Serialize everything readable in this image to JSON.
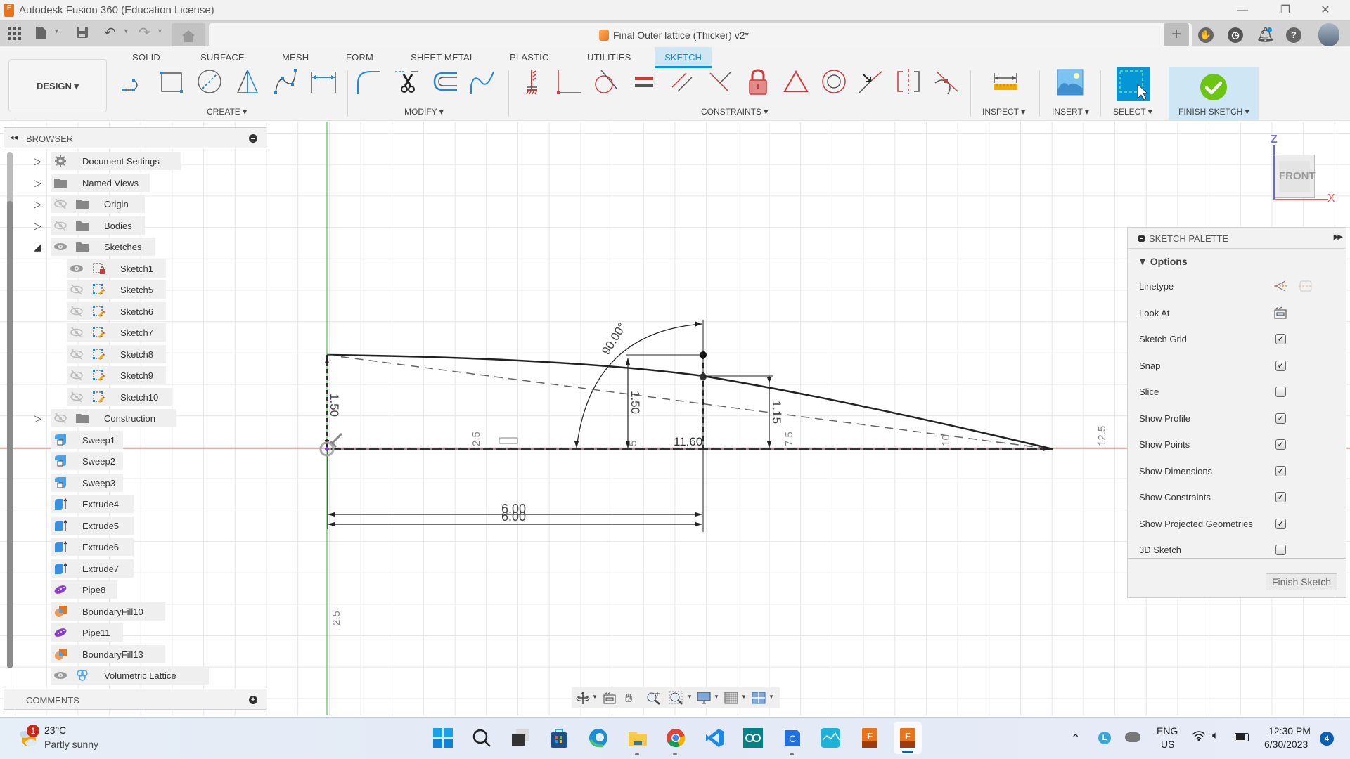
{
  "window": {
    "app_title": "Autodesk Fusion 360 (Education License)",
    "app_icon_letter": "F",
    "controls": {
      "minimize": "—",
      "restore": "❐",
      "close": "✕"
    }
  },
  "app_toolbar": {
    "document_tab": "Final Outer lattice (Thicker) v2*",
    "close_tab": "×",
    "new_tab": "+"
  },
  "ribbon": {
    "workspace": "DESIGN ▾",
    "tabs": [
      "SOLID",
      "SURFACE",
      "MESH",
      "FORM",
      "SHEET METAL",
      "PLASTIC",
      "UTILITIES",
      "SKETCH"
    ],
    "active_tab": "SKETCH",
    "groups": {
      "create": "CREATE ▾",
      "modify": "MODIFY ▾",
      "constraints": "CONSTRAINTS ▾",
      "inspect": "INSPECT ▾",
      "insert": "INSERT ▾",
      "select": "SELECT ▾",
      "finish": "FINISH SKETCH ▾"
    },
    "create_tools": [
      "line-icon",
      "rectangle-icon",
      "circle-icon",
      "polygon-icon",
      "spline-icon",
      "dimension-icon"
    ],
    "modify_tools": [
      "fillet-icon",
      "trim-icon",
      "offset-icon",
      "curve-icon"
    ],
    "constraint_tools": [
      "fix-icon",
      "perpendicular-icon",
      "tangent-icon",
      "equal-icon",
      "parallel-icon",
      "perpendicular-alt-icon",
      "lock-icon",
      "triangle-icon",
      "concentric-icon",
      "midpoint-icon",
      "symmetry-icon",
      "coincident-icon"
    ]
  },
  "browser": {
    "title": "BROWSER",
    "items": [
      {
        "label": "Document Settings",
        "icon": "gear-icon",
        "expander": "▷",
        "eye": null
      },
      {
        "label": "Named Views",
        "icon": "folder-icon",
        "expander": "▷",
        "eye": null
      },
      {
        "label": "Origin",
        "icon": "folder-icon",
        "expander": "▷",
        "eye": "hidden"
      },
      {
        "label": "Bodies",
        "icon": "folder-icon",
        "expander": "▷",
        "eye": "hidden"
      },
      {
        "label": "Sketches",
        "icon": "folder-icon",
        "expander": "◢",
        "eye": "visible"
      },
      {
        "label": "Sketch1",
        "icon": "sketch-locked-icon",
        "eye": "visible",
        "child": true
      },
      {
        "label": "Sketch5",
        "icon": "sketch-icon",
        "eye": "hidden",
        "child": true
      },
      {
        "label": "Sketch6",
        "icon": "sketch-icon",
        "eye": "hidden",
        "child": true
      },
      {
        "label": "Sketch7",
        "icon": "sketch-icon",
        "eye": "hidden",
        "child": true
      },
      {
        "label": "Sketch8",
        "icon": "sketch-icon",
        "eye": "hidden",
        "child": true
      },
      {
        "label": "Sketch9",
        "icon": "sketch-icon",
        "eye": "hidden",
        "child": true
      },
      {
        "label": "Sketch10",
        "icon": "sketch-icon",
        "eye": "hidden",
        "child": true
      },
      {
        "label": "Construction",
        "icon": "folder-icon",
        "expander": "▷",
        "eye": "hidden"
      },
      {
        "label": "Sweep1",
        "icon": "sweep-icon"
      },
      {
        "label": "Sweep2",
        "icon": "sweep-icon"
      },
      {
        "label": "Sweep3",
        "icon": "sweep-icon"
      },
      {
        "label": "Extrude4",
        "icon": "extrude-icon"
      },
      {
        "label": "Extrude5",
        "icon": "extrude-icon"
      },
      {
        "label": "Extrude6",
        "icon": "extrude-icon"
      },
      {
        "label": "Extrude7",
        "icon": "extrude-icon"
      },
      {
        "label": "Pipe8",
        "icon": "pipe-icon"
      },
      {
        "label": "BoundaryFill10",
        "icon": "boundary-fill-icon"
      },
      {
        "label": "Pipe11",
        "icon": "pipe-icon"
      },
      {
        "label": "BoundaryFill13",
        "icon": "boundary-fill-icon"
      },
      {
        "label": "Volumetric Lattice",
        "icon": "lattice-icon",
        "eye": "visible"
      }
    ],
    "comments_title": "COMMENTS"
  },
  "viewcube": {
    "face": "FRONT",
    "axis_z": "Z",
    "axis_x": "X"
  },
  "sketch_palette": {
    "title": "SKETCH PALETTE",
    "section": "▼ Options",
    "rows": [
      {
        "label": "Linetype",
        "type": "icons"
      },
      {
        "label": "Look At",
        "type": "icon"
      },
      {
        "label": "Sketch Grid",
        "type": "checkbox",
        "checked": true
      },
      {
        "label": "Snap",
        "type": "checkbox",
        "checked": true
      },
      {
        "label": "Slice",
        "type": "checkbox",
        "checked": false
      },
      {
        "label": "Show Profile",
        "type": "checkbox",
        "checked": true
      },
      {
        "label": "Show Points",
        "type": "checkbox",
        "checked": true
      },
      {
        "label": "Show Dimensions",
        "type": "checkbox",
        "checked": true
      },
      {
        "label": "Show Constraints",
        "type": "checkbox",
        "checked": true
      },
      {
        "label": "Show Projected Geometries",
        "type": "checkbox",
        "checked": true
      },
      {
        "label": "3D Sketch",
        "type": "checkbox",
        "checked": false
      }
    ],
    "finish_button": "Finish Sketch"
  },
  "sketch": {
    "dimensions": {
      "left_height": "1.50",
      "mid_height": "1.50",
      "right_height": "1.15",
      "angle": "90.00°",
      "length_a": "6.00",
      "length_b": "6.00",
      "horizontal": "11.60"
    },
    "grid_labels": [
      "2.5",
      "5",
      "7.5",
      "10",
      "12.5",
      "2.5"
    ]
  },
  "navbar": [
    "orbit-icon",
    "look-at-icon",
    "pan-icon",
    "zoom-icon",
    "fit-icon",
    "display-settings-icon",
    "grid-settings-icon",
    "viewports-icon"
  ],
  "taskbar": {
    "weather_temp": "23°C",
    "weather_desc": "Partly sunny",
    "weather_badge": "1",
    "apps": [
      "start-icon",
      "search-icon",
      "task-view-icon",
      "store-icon",
      "edge-icon",
      "file-explorer-icon",
      "chrome-icon",
      "vscode-icon",
      "arduino-icon",
      "c-app-icon",
      "cura-icon",
      "fusion360-icon",
      "fusion360-active-icon"
    ],
    "lang_top": "ENG",
    "lang_bottom": "US",
    "time": "12:30 PM",
    "date": "6/30/2023",
    "notification_count": "4"
  },
  "colors": {
    "accent": "#0696d7",
    "sketch_tab_bg": "#cfe7f5",
    "finish_green": "#6cc413",
    "constraint_red": "#d63838",
    "axis_x": "#e45c5c",
    "axis_y": "#46c846"
  }
}
